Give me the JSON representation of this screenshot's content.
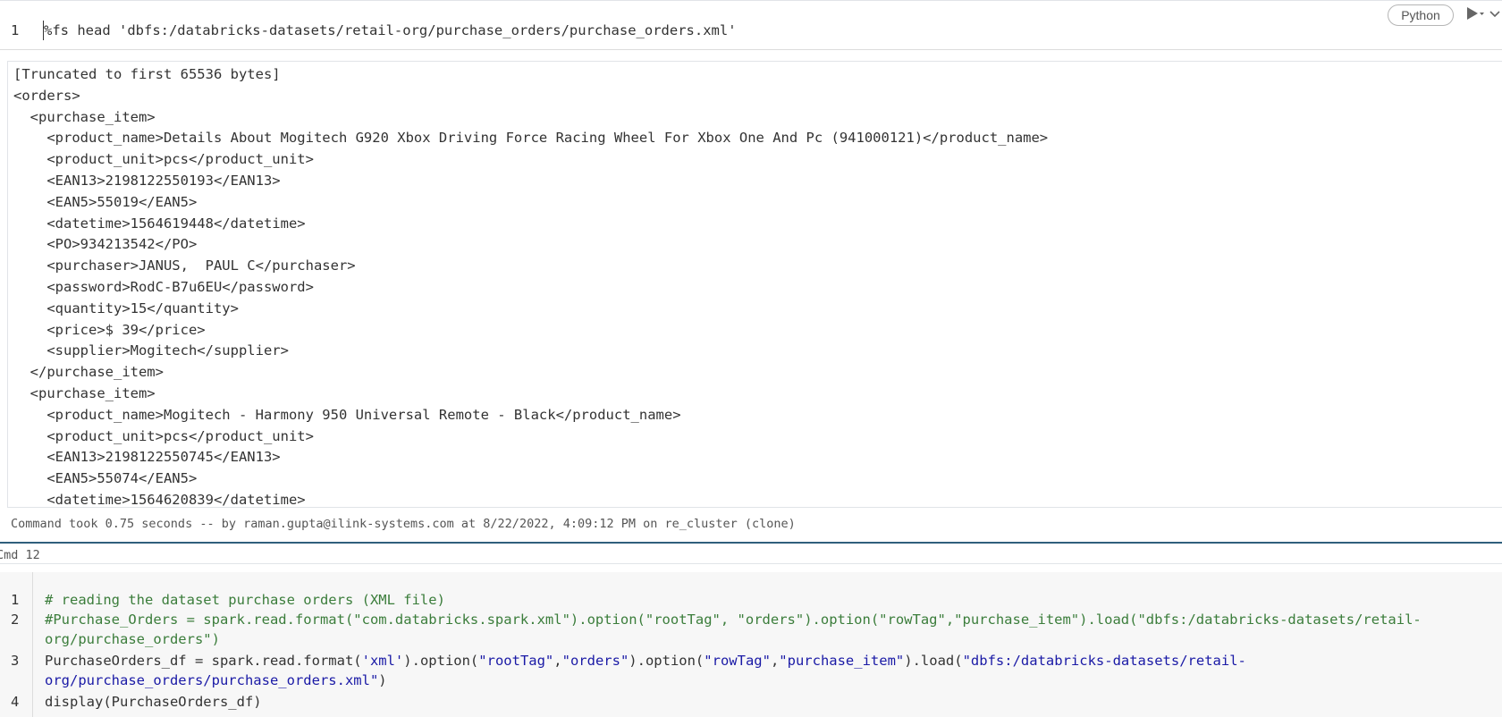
{
  "top_cell": {
    "line_number": "1",
    "code": "%fs head 'dbfs:/databricks-datasets/retail-org/purchase_orders/purchase_orders.xml'",
    "language_label": "Python",
    "output_lines": [
      "[Truncated to first 65536 bytes]",
      "<orders>",
      "  <purchase_item>",
      "    <product_name>Details About Mogitech G920 Xbox Driving Force Racing Wheel For Xbox One And Pc (941000121)</product_name>",
      "    <product_unit>pcs</product_unit>",
      "    <EAN13>2198122550193</EAN13>",
      "    <EAN5>55019</EAN5>",
      "    <datetime>1564619448</datetime>",
      "    <PO>934213542</PO>",
      "    <purchaser>JANUS,  PAUL C</purchaser>",
      "    <password>RodC-B7u6EU</password>",
      "    <quantity>15</quantity>",
      "    <price>$ 39</price>",
      "    <supplier>Mogitech</supplier>",
      "  </purchase_item>",
      "  <purchase_item>",
      "    <product_name>Mogitech - Harmony 950 Universal Remote - Black</product_name>",
      "    <product_unit>pcs</product_unit>",
      "    <EAN13>2198122550745</EAN13>",
      "    <EAN5>55074</EAN5>",
      "    <datetime>1564620839</datetime>"
    ],
    "status": "Command took 0.75 seconds -- by raman.gupta@ilink-systems.com at 8/22/2022, 4:09:12 PM on re_cluster (clone)"
  },
  "cmd_label": "Cmd 12",
  "bottom_cell": {
    "line_numbers": [
      "1",
      "2",
      "3",
      "4"
    ],
    "line1": "# reading the dataset purchase orders (XML file)",
    "line2a": "#Purchase_Orders = spark.read.format(\"com.databricks.spark.xml\").option(\"rootTag\", \"orders\").option(\"rowTag\",\"purchase_item\").load(\"dbfs:/databricks-datasets/retail-",
    "line2b": "org/purchase_orders\")",
    "line3": {
      "p1": "PurchaseOrders_df = spark.read.format(",
      "s1": "'xml'",
      "p2": ").option(",
      "s2": "\"rootTag\"",
      "p3": ",",
      "s3": "\"orders\"",
      "p4": ").option(",
      "s4": "\"rowTag\"",
      "p5": ",",
      "s5": "\"purchase_item\"",
      "p6": ").load(",
      "s6": "\"dbfs:/databricks-datasets/retail-",
      "s7": "org/purchase_orders/purchase_orders.xml\"",
      "p7": ")"
    },
    "line4": "display(PurchaseOrders_df)"
  }
}
